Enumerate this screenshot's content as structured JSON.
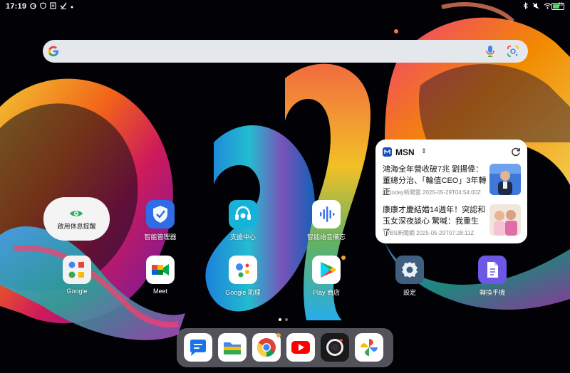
{
  "status_bar": {
    "time": "17:19",
    "left_icons": [
      "google-g-icon",
      "shield-icon",
      "notes-icon",
      "task-icon",
      "dot-icon"
    ],
    "right_icons": [
      "bluetooth-icon",
      "mute-icon",
      "wifi-icon"
    ],
    "battery_level": "33"
  },
  "search_bar": {
    "icons": [
      "google-logo-icon",
      "microphone-icon",
      "google-lens-icon"
    ]
  },
  "msn_widget": {
    "title": "MSN",
    "caret": "⇕",
    "news": [
      {
        "headline": "鴻海全年營收破7兆 劉揚偉：董總分治、「輪值CEO」3年轉正",
        "source": "ETtoday新聞雲 2025-05-29T04:54:00Z"
      },
      {
        "headline": "康康才慶結婚14週年！突認和玉女深夜談心 驚喊：我重生了",
        "source": "TVBS新聞網 2025-05-29T07:28:11Z"
      }
    ]
  },
  "rest_widget": {
    "label": "啟用休息提醒"
  },
  "apps_row1": [
    {
      "label": "智能管理器"
    },
    {
      "label": "支援中心"
    },
    {
      "label": "智能語音備忘"
    }
  ],
  "apps_row2": [
    {
      "label": "Google"
    },
    {
      "label": "Meet"
    },
    {
      "label": "Google 助理"
    },
    {
      "label": "Play 商店"
    },
    {
      "label": "設定"
    },
    {
      "label": "轉換手機"
    }
  ],
  "page_indicator": {
    "pages": 2,
    "active": 1
  },
  "dock": [
    "messages-icon",
    "files-icon",
    "chrome-icon",
    "youtube-icon",
    "camera-icon",
    "photos-icon"
  ],
  "colors": {
    "widget_bg": "#ffffff",
    "search_bg": "#e4e8ec",
    "dock_bg": "#8c8c96"
  }
}
